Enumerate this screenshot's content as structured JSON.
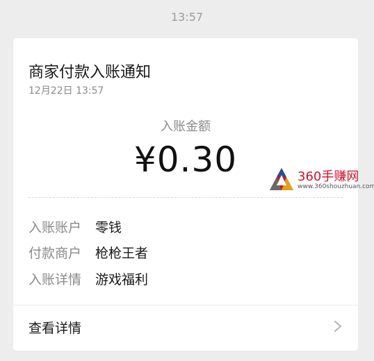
{
  "timestamp": "13:57",
  "card": {
    "title": "商家付款入账通知",
    "date": "12月22日  13:57",
    "amount_label": "入账金额",
    "amount": "¥0.30",
    "rows": [
      {
        "key": "入账账户",
        "value": "零钱"
      },
      {
        "key": "付款商户",
        "value": "枪枪王者"
      },
      {
        "key": "入账详情",
        "value": "游戏福利"
      }
    ],
    "detail_label": "查看详情"
  },
  "watermark": {
    "name": "360手赚网",
    "url": "www.360shouzhuan.com"
  },
  "icons": {
    "chevron": "chevron-right-icon",
    "logo": "360-logo-icon"
  },
  "colors": {
    "background": "#ededed",
    "card": "#ffffff",
    "watermark_red": "#d0122b"
  }
}
